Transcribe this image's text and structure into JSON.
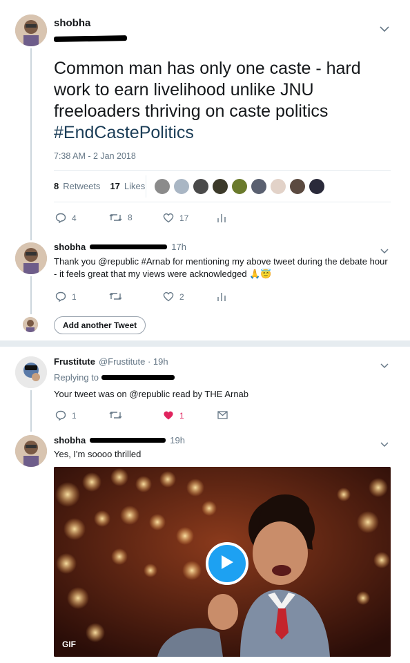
{
  "tweet1": {
    "name": "shobha",
    "text_plain": "Common man has only one caste - hard work to earn livelihood unlike JNU freeloaders thriving on caste politics",
    "hashtag": "#EndCastePolitics",
    "timestamp": "7:38 AM - 2 Jan 2018",
    "retweets_count": "8",
    "retweets_label": "Retweets",
    "likes_count": "17",
    "likes_label": "Likes",
    "reply_count": "4",
    "retweet_count": "8",
    "like_count": "17"
  },
  "tweet2": {
    "name": "shobha",
    "time": "17h",
    "text": "Thank you @republic #Arnab for mentioning my above tweet during the debate hour - it feels great that my views were acknowledged 🙏😇",
    "reply_count": "1",
    "retweet_count": "",
    "like_count": "2"
  },
  "add_tweet": {
    "label": "Add another Tweet"
  },
  "tweet3": {
    "name": "Frustitute",
    "handle_time": "@Frustitute · 19h",
    "replying_prefix": "Replying to",
    "text": "Your tweet was on @republic read by THE Arnab",
    "reply_count": "1",
    "like_count": "1"
  },
  "tweet4": {
    "name": "shobha",
    "time": "19h",
    "text": "Yes, I'm soooo thrilled",
    "media_label": "GIF"
  },
  "colors": {
    "accent": "#1da1f2",
    "like_red": "#e0245e",
    "muted": "#657786",
    "hashtag": "#1b3d57"
  }
}
